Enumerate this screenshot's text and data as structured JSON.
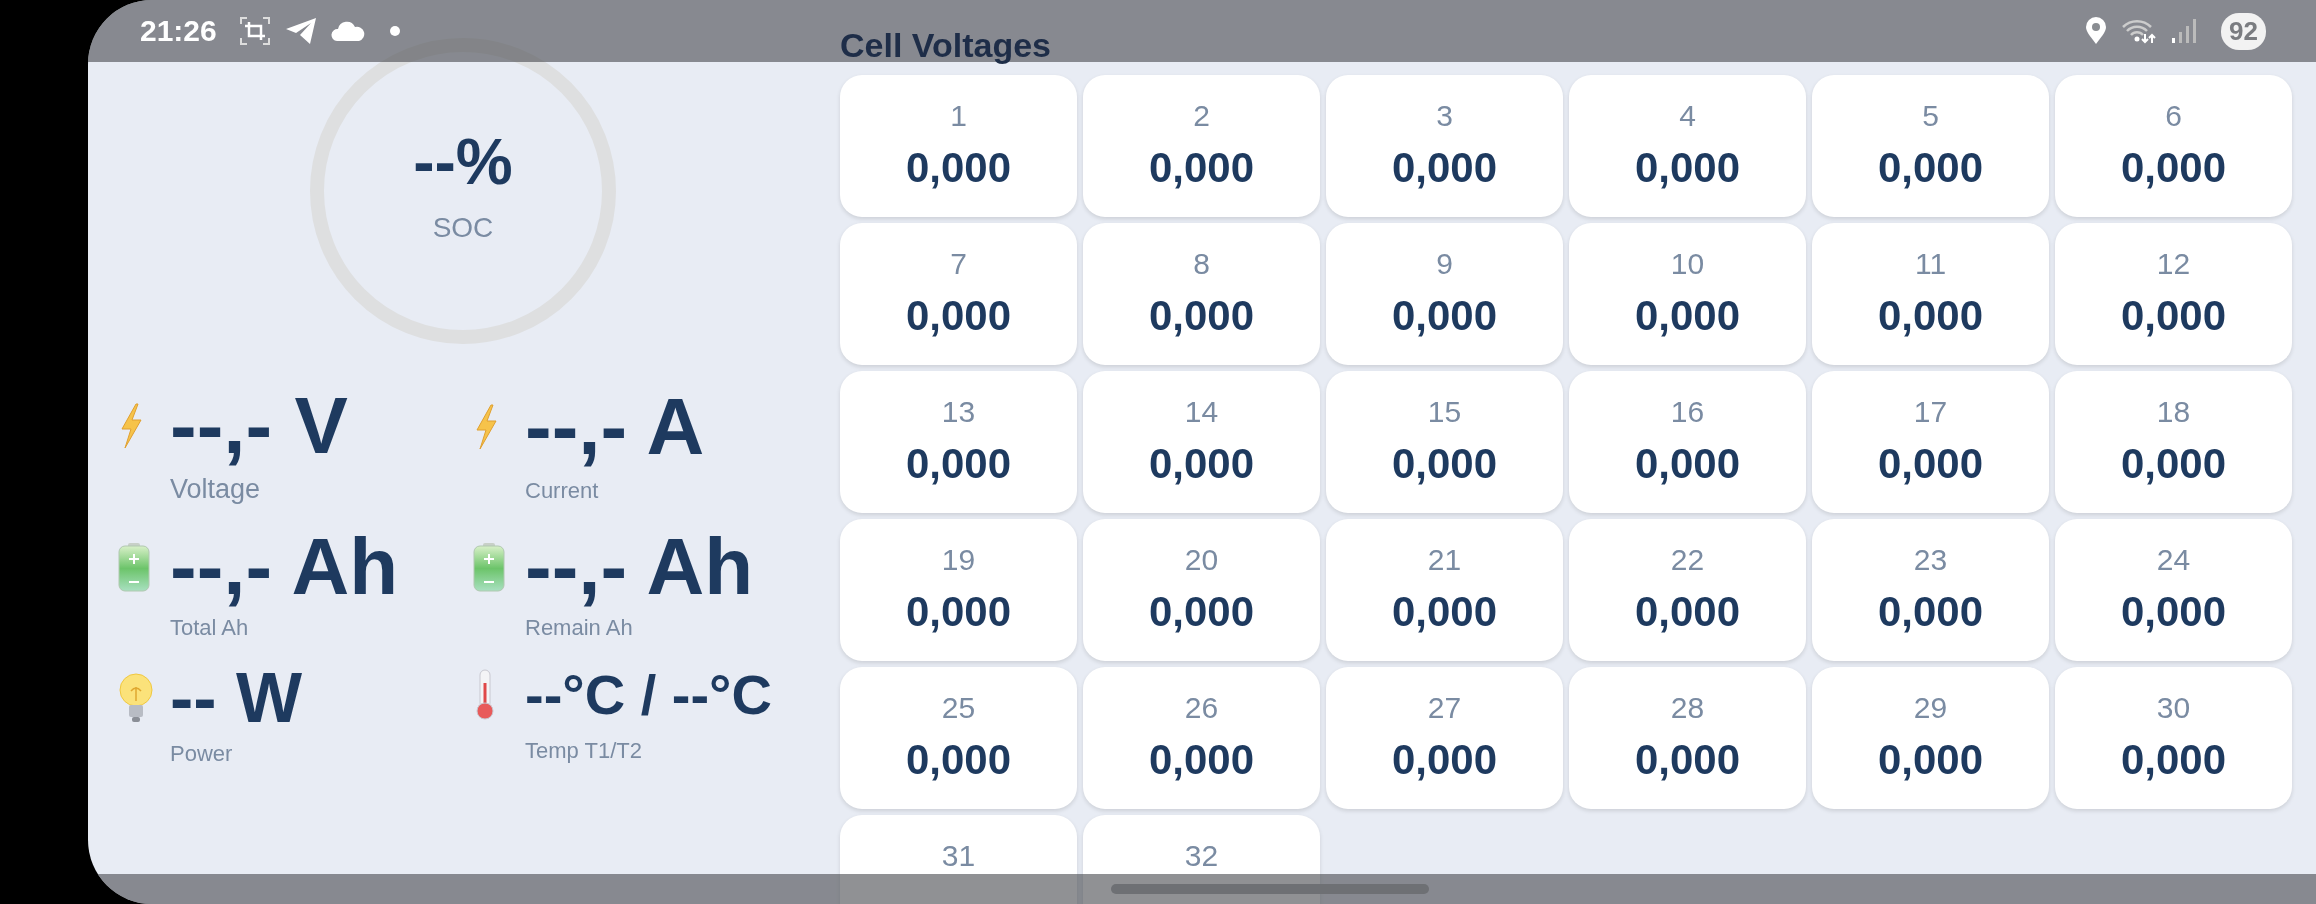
{
  "status_bar": {
    "time": "21:26",
    "battery": "92"
  },
  "soc": {
    "value": "--%",
    "label": "SOC"
  },
  "metrics": [
    {
      "kind": "voltage",
      "value": "--,- V",
      "label": "Voltage"
    },
    {
      "kind": "current",
      "value": "--,- A",
      "label": "Current"
    },
    {
      "kind": "total_capacity",
      "value": "--,- Ah",
      "label": "Total Ah"
    },
    {
      "kind": "remain_capacity",
      "value": "--,- Ah",
      "label": "Remain Ah"
    },
    {
      "kind": "power",
      "value": "-- W",
      "label": "Power"
    },
    {
      "kind": "temperature",
      "value": "--°C / --°C",
      "label": "Temp T1/T2"
    }
  ],
  "cell_voltages": {
    "title": "Cell Voltages",
    "cells": [
      {
        "number": "1",
        "value": "0,000"
      },
      {
        "number": "2",
        "value": "0,000"
      },
      {
        "number": "3",
        "value": "0,000"
      },
      {
        "number": "4",
        "value": "0,000"
      },
      {
        "number": "5",
        "value": "0,000"
      },
      {
        "number": "6",
        "value": "0,000"
      },
      {
        "number": "7",
        "value": "0,000"
      },
      {
        "number": "8",
        "value": "0,000"
      },
      {
        "number": "9",
        "value": "0,000"
      },
      {
        "number": "10",
        "value": "0,000"
      },
      {
        "number": "11",
        "value": "0,000"
      },
      {
        "number": "12",
        "value": "0,000"
      },
      {
        "number": "13",
        "value": "0,000"
      },
      {
        "number": "14",
        "value": "0,000"
      },
      {
        "number": "15",
        "value": "0,000"
      },
      {
        "number": "16",
        "value": "0,000"
      },
      {
        "number": "17",
        "value": "0,000"
      },
      {
        "number": "18",
        "value": "0,000"
      },
      {
        "number": "19",
        "value": "0,000"
      },
      {
        "number": "20",
        "value": "0,000"
      },
      {
        "number": "21",
        "value": "0,000"
      },
      {
        "number": "22",
        "value": "0,000"
      },
      {
        "number": "23",
        "value": "0,000"
      },
      {
        "number": "24",
        "value": "0,000"
      },
      {
        "number": "25",
        "value": "0,000"
      },
      {
        "number": "26",
        "value": "0,000"
      },
      {
        "number": "27",
        "value": "0,000"
      },
      {
        "number": "28",
        "value": "0,000"
      },
      {
        "number": "29",
        "value": "0,000"
      },
      {
        "number": "30",
        "value": "0,000"
      },
      {
        "number": "31"
      },
      {
        "number": "32"
      }
    ]
  }
}
